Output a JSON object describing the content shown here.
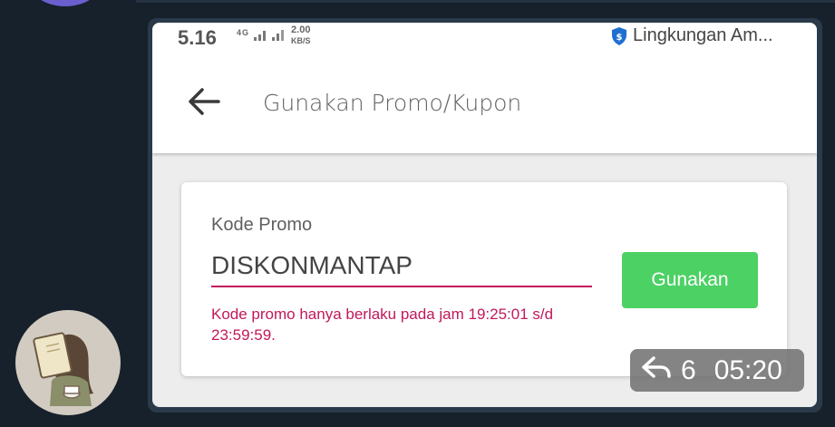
{
  "status_bar": {
    "time": "5.16",
    "network_label": "4G",
    "speed_value": "2.00",
    "speed_unit": "KB/S",
    "environment_label": "Lingkungan Am..."
  },
  "header": {
    "title": "Gunakan Promo/Kupon",
    "back_icon": "arrow-left-icon"
  },
  "promo": {
    "field_label": "Kode Promo",
    "code_value": "DISKONMANTAP",
    "apply_label": "Gunakan",
    "error_message": "Kode promo hanya berlaku pada jam 19:25:01 s/d 23:59:59.",
    "accent_color": "#c2185b",
    "button_color": "#4cd164"
  },
  "message_meta": {
    "reply_icon": "reply-icon",
    "reply_count": "6",
    "time": "05:20"
  }
}
